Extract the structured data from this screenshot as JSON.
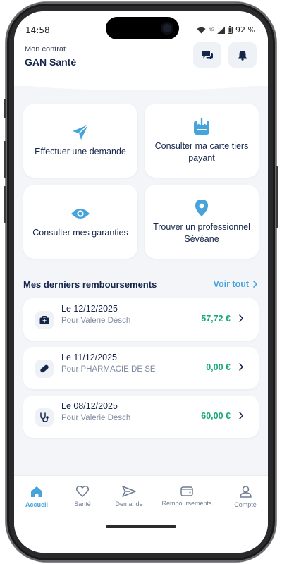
{
  "status": {
    "time": "14:58",
    "network": "4G",
    "battery": "92 %"
  },
  "header": {
    "subtitle": "Mon contrat",
    "title": "GAN Santé"
  },
  "actions": [
    {
      "label": "Effectuer une demande",
      "icon": "paper-plane-icon"
    },
    {
      "label": "Consulter ma carte tiers payant",
      "icon": "download-card-icon"
    },
    {
      "label": "Consulter mes garanties",
      "icon": "eye-icon"
    },
    {
      "label": "Trouver un professionnel Sévéane",
      "icon": "location-pin-icon"
    }
  ],
  "reimbursements_section": {
    "title": "Mes derniers remboursements",
    "see_all": "Voir tout"
  },
  "reimbursements": [
    {
      "date": "Le 12/12/2025",
      "who": "Pour Valerie Desch",
      "amount": "57,72 €",
      "icon": "medical-kit-icon"
    },
    {
      "date": "Le 11/12/2025",
      "who": "Pour PHARMACIE DE SE",
      "amount": "0,00 €",
      "icon": "pill-icon"
    },
    {
      "date": "Le 08/12/2025",
      "who": "Pour Valerie Desch",
      "amount": "60,00 €",
      "icon": "stethoscope-icon"
    }
  ],
  "tabs": [
    {
      "label": "Accueil",
      "icon": "home-icon",
      "active": true
    },
    {
      "label": "Santé",
      "icon": "heart-icon",
      "active": false
    },
    {
      "label": "Demande",
      "icon": "send-icon",
      "active": false
    },
    {
      "label": "Remboursements",
      "icon": "wallet-icon",
      "active": false
    },
    {
      "label": "Compte",
      "icon": "user-icon",
      "active": false
    }
  ],
  "colors": {
    "accent": "#46a4db",
    "navy": "#14254a",
    "amount_green": "#19a878",
    "background": "#f3f5f9"
  }
}
